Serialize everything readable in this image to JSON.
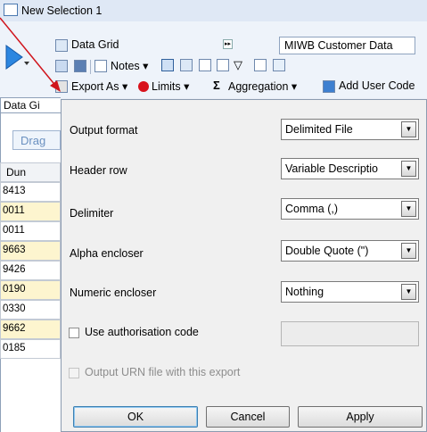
{
  "window": {
    "title": "New Selection 1"
  },
  "toolbar": {
    "view_select": "Data Grid",
    "dataset_box": "MIWB Customer Data",
    "notes_label": "Notes",
    "export_label": "Export As",
    "limits_label": "Limits",
    "aggregation_label": "Aggregation",
    "add_user_code_label": "Add User Code"
  },
  "grid": {
    "tab_label": "Data Gi",
    "drag_hint": "Drag",
    "column_header": "Dun",
    "rows": [
      "8413",
      "0011",
      "0011",
      "9663",
      "9426",
      "0190",
      "0330",
      "9662",
      "0185"
    ]
  },
  "dialog": {
    "output_format": {
      "label": "Output format",
      "value": "Delimited File"
    },
    "header_row": {
      "label": "Header row",
      "value": "Variable Descriptio"
    },
    "delimiter": {
      "label": "Delimiter",
      "value": "Comma (,)"
    },
    "alpha_encloser": {
      "label": "Alpha encloser",
      "value": "Double Quote (\")"
    },
    "numeric_encloser": {
      "label": "Numeric encloser",
      "value": "Nothing"
    },
    "use_auth_code": {
      "label": "Use authorisation code"
    },
    "output_urn": {
      "label": "Output URN file with this export"
    },
    "buttons": {
      "ok": "OK",
      "cancel": "Cancel",
      "apply": "Apply"
    }
  },
  "colors": {
    "accent_blue": "#1e73d8",
    "row_highlight": "#fdf5cf",
    "arrow_annotation": "#d0141c"
  }
}
